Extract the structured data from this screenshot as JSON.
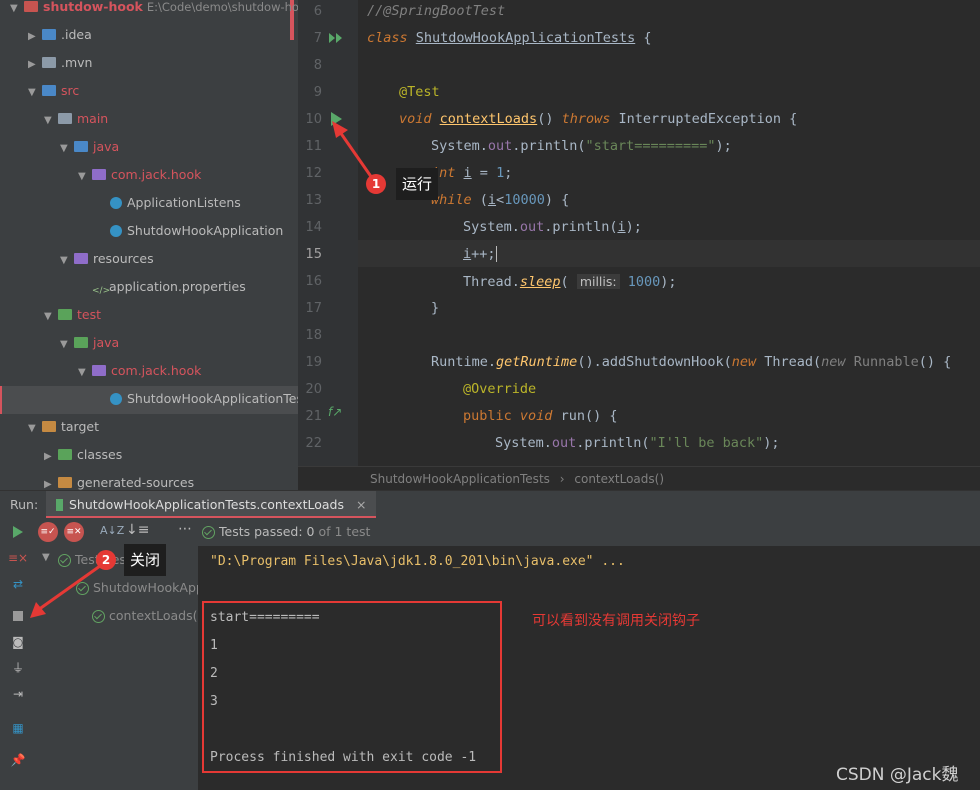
{
  "project": {
    "root_name": "shutdow-hook",
    "root_path": "E:\\Code\\demo\\shutdow-ho",
    "items": [
      {
        "label": ".idea"
      },
      {
        "label": ".mvn"
      },
      {
        "label": "src"
      },
      {
        "label": "main"
      },
      {
        "label": "java"
      },
      {
        "label": "com.jack.hook"
      },
      {
        "label": "ApplicationListens"
      },
      {
        "label": "ShutdowHookApplication"
      },
      {
        "label": "resources"
      },
      {
        "label": "application.properties"
      },
      {
        "label": "test"
      },
      {
        "label": "java"
      },
      {
        "label": "com.jack.hook"
      },
      {
        "label": "ShutdowHookApplicationTest"
      },
      {
        "label": "target"
      },
      {
        "label": "classes"
      },
      {
        "label": "generated-sources"
      }
    ]
  },
  "editor": {
    "line_numbers": [
      "6",
      "7",
      "8",
      "9",
      "10",
      "11",
      "12",
      "13",
      "14",
      "15",
      "16",
      "17",
      "18",
      "19",
      "20",
      "21",
      "22"
    ],
    "breadcrumb": [
      "ShutdowHookApplicationTests",
      "contextLoads()"
    ],
    "param_hint": "millis:"
  },
  "run": {
    "label": "Run:",
    "tab": "ShutdowHookApplicationTests.contextLoads",
    "close": "×",
    "status": "Tests passed:",
    "status_count": "0",
    "status_suffix": "of 1 test",
    "tree": [
      "Test Results",
      "ShutdowHookApp",
      "contextLoads()"
    ],
    "console": {
      "cmd": "\"D:\\Program Files\\Java\\jdk1.8.0_201\\bin\\java.exe\" ...",
      "lines": [
        "start=========",
        "1",
        "2",
        "3",
        "",
        "Process finished with exit code -1"
      ]
    }
  },
  "annotations": {
    "badge1": "1",
    "tip1": "运行",
    "badge2": "2",
    "tip2": "关闭",
    "note": "可以看到没有调用关闭钩子",
    "watermark": "CSDN @Jack魏"
  },
  "colors": {
    "accent_red": "#e53935",
    "run_green": "#59a869"
  }
}
